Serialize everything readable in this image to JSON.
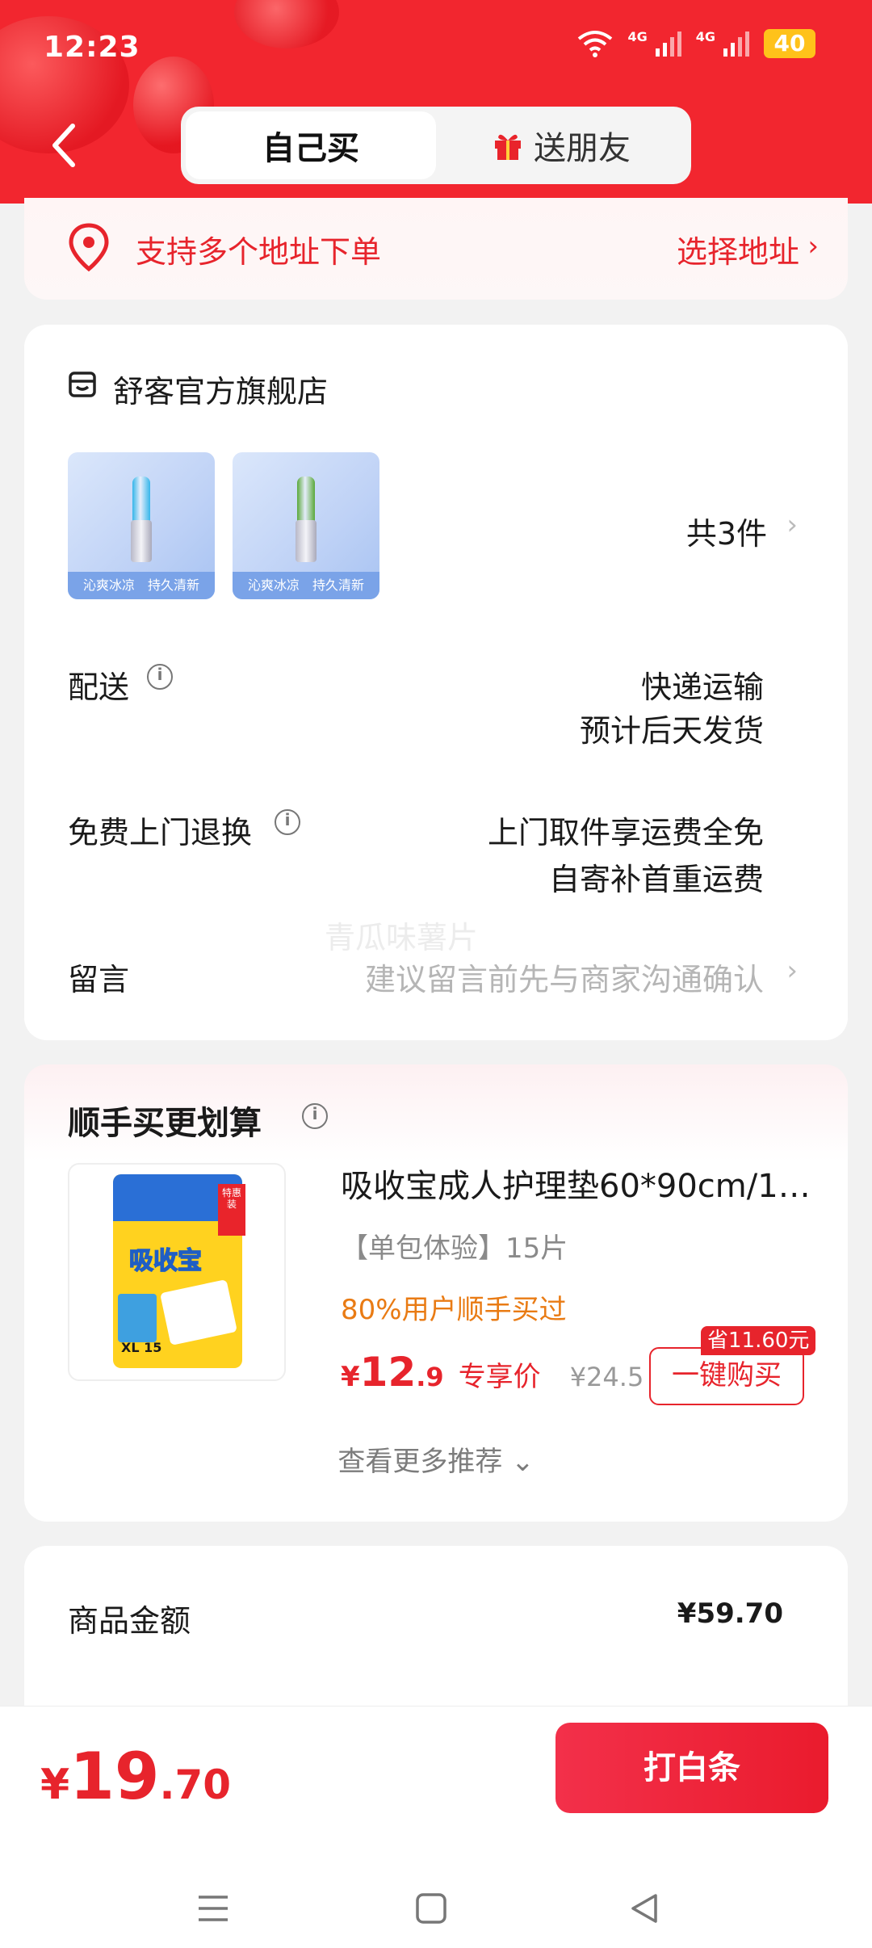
{
  "status_bar": {
    "time": "12:23",
    "net_1": "4G",
    "net_2": "4G",
    "battery": "40"
  },
  "header": {
    "tabs": [
      {
        "label": "自己买",
        "active": true
      },
      {
        "label": "送朋友",
        "active": false,
        "icon": "gift-icon"
      }
    ]
  },
  "address": {
    "text": "支持多个地址下单",
    "action": "选择地址",
    "chevron": "›"
  },
  "store": {
    "name": "舒客官方旗舰店",
    "products": [
      {
        "caption": "沁爽冰凉　持久清新",
        "cap_color": "#35b6ea"
      },
      {
        "caption": "沁爽冰凉　持久清新",
        "cap_color": "#5aa83a"
      }
    ],
    "count": "共3件",
    "chevron": "›",
    "delivery": {
      "label": "配送",
      "method": "快递运输",
      "eta": "预计后天发货"
    },
    "return": {
      "label": "免费上门退换",
      "line1": "上门取件享运费全免",
      "line2": "自寄补首重运费"
    },
    "message": {
      "label": "留言",
      "placeholder": "建议留言前先与商家沟通确认",
      "ghost": "青瓜味薯片"
    }
  },
  "recommend": {
    "title": "顺手买更划算",
    "item": {
      "name": "吸收宝成人护理垫60*90cm/15...",
      "spec": "【单包体验】15片",
      "stat": "80%用户顺手买过",
      "price_symbol": "¥",
      "price_int": "12",
      "price_dec": ".9",
      "price_tag": "专享价",
      "original_price": "¥24.5",
      "save_badge": "省11.60元",
      "buy_label": "一键购买",
      "pack_brand": "吸收宝",
      "pack_size": "XL 15",
      "pack_tag": "特惠装"
    },
    "more": "查看更多推荐 ⌄"
  },
  "amount": {
    "label": "商品金额",
    "value": "¥59.70"
  },
  "bottom": {
    "total_symbol": "¥",
    "total_int": "19",
    "total_dec": ".70",
    "pay_label": "打白条"
  },
  "colors": {
    "brand_red": "#f2262f",
    "price_red": "#e7242c",
    "stat_orange": "#e97b14"
  }
}
